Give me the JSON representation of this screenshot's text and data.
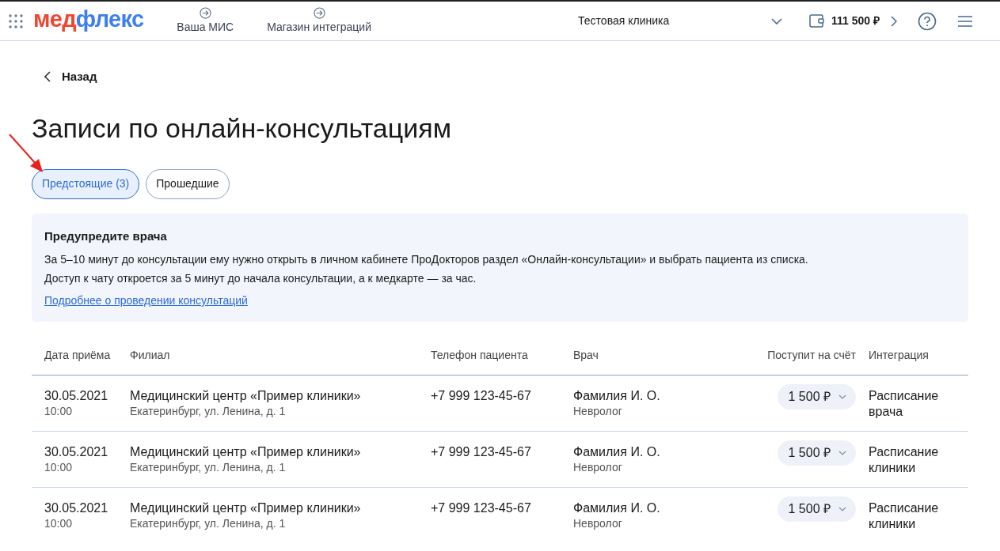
{
  "header": {
    "logo": [
      {
        "text": "мед",
        "color": "#f0462f"
      },
      {
        "text": "флекс",
        "color": "#3d7ff0"
      }
    ],
    "nav": [
      {
        "label": "Ваша МИС"
      },
      {
        "label": "Магазин интеграций"
      }
    ],
    "clinic": "Тестовая клиника",
    "balance": "111 500 ₽"
  },
  "back": "Назад",
  "title": "Записи по онлайн-консультациям",
  "tabs": [
    {
      "label": "Предстоящие (3)",
      "selected": true
    },
    {
      "label": "Прошедшие",
      "selected": false
    }
  ],
  "notice": {
    "title": "Предупредите врача",
    "lines": [
      "За 5–10 минут до консультации ему нужно открыть в личном кабинете ПроДокторов раздел «Онлайн-консультации» и выбрать пациента из списка.",
      "Доступ к чату откроется за 5 минут до начала консультации, а к медкарте — за час."
    ],
    "link": "Подробнее о проведении консультаций"
  },
  "table": {
    "columns": [
      "Дата приёма",
      "Филиал",
      "Телефон пациента",
      "Врач",
      "Поступит на счёт",
      "Интеграция"
    ],
    "rows": [
      {
        "date": "30.05.2021",
        "time": "10:00",
        "branch": "Медицинский центр «Пример клиники»",
        "address": "Екатеринбург, ул. Ленина, д. 1",
        "phone": "+7 999 123-45-67",
        "doctor": "Фамилия И. О.",
        "specialty": "Невролог",
        "amount": "1 500 ₽",
        "integration": "Расписание врача"
      },
      {
        "date": "30.05.2021",
        "time": "10:00",
        "branch": "Медицинский центр «Пример клиники»",
        "address": "Екатеринбург, ул. Ленина, д. 1",
        "phone": "+7 999 123-45-67",
        "doctor": "Фамилия И. О.",
        "specialty": "Невролог",
        "amount": "1 500 ₽",
        "integration": "Расписание клиники"
      },
      {
        "date": "30.05.2021",
        "time": "10:00",
        "branch": "Медицинский центр «Пример клиники»",
        "address": "Екатеринбург, ул. Ленина, д. 1",
        "phone": "+7 999 123-45-67",
        "doctor": "Фамилия И. О.",
        "specialty": "Невролог",
        "amount": "1 500 ₽",
        "integration": "Расписание клиники"
      }
    ]
  }
}
